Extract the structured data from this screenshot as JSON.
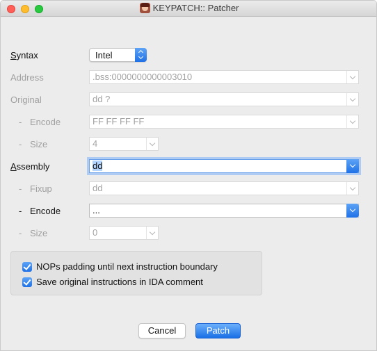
{
  "window": {
    "title": "KEYPATCH:: Patcher"
  },
  "form": {
    "syntax": {
      "label_u": "S",
      "label_rest": "yntax",
      "value": "Intel"
    },
    "address": {
      "label": "Address",
      "value": ".bss:0000000000003010"
    },
    "original": {
      "label": "Original",
      "value": "dd ?"
    },
    "original_encode": {
      "dash": "-",
      "label": "Encode",
      "value": "FF FF FF FF"
    },
    "original_size": {
      "dash": "-",
      "label": "Size",
      "value": "4"
    },
    "assembly": {
      "label_u": "A",
      "label_rest": "ssembly",
      "value": "dd"
    },
    "fixup": {
      "dash": "-",
      "label": "Fixup",
      "value": "dd"
    },
    "asm_encode": {
      "dash": "-",
      "label": "Encode",
      "value": "..."
    },
    "asm_size": {
      "dash": "-",
      "label": "Size",
      "value": "0"
    }
  },
  "options": {
    "nops_label": "NOPs padding until next instruction boundary",
    "nops_checked": true,
    "save_label": "Save original instructions in IDA comment",
    "save_checked": true
  },
  "buttons": {
    "cancel": "Cancel",
    "patch": "Patch"
  },
  "colors": {
    "accent": "#1f71e6",
    "focus_ring": "#aecbf3",
    "close": "#ff5f57",
    "minimize": "#ffbd2e",
    "maximize": "#28c940"
  }
}
